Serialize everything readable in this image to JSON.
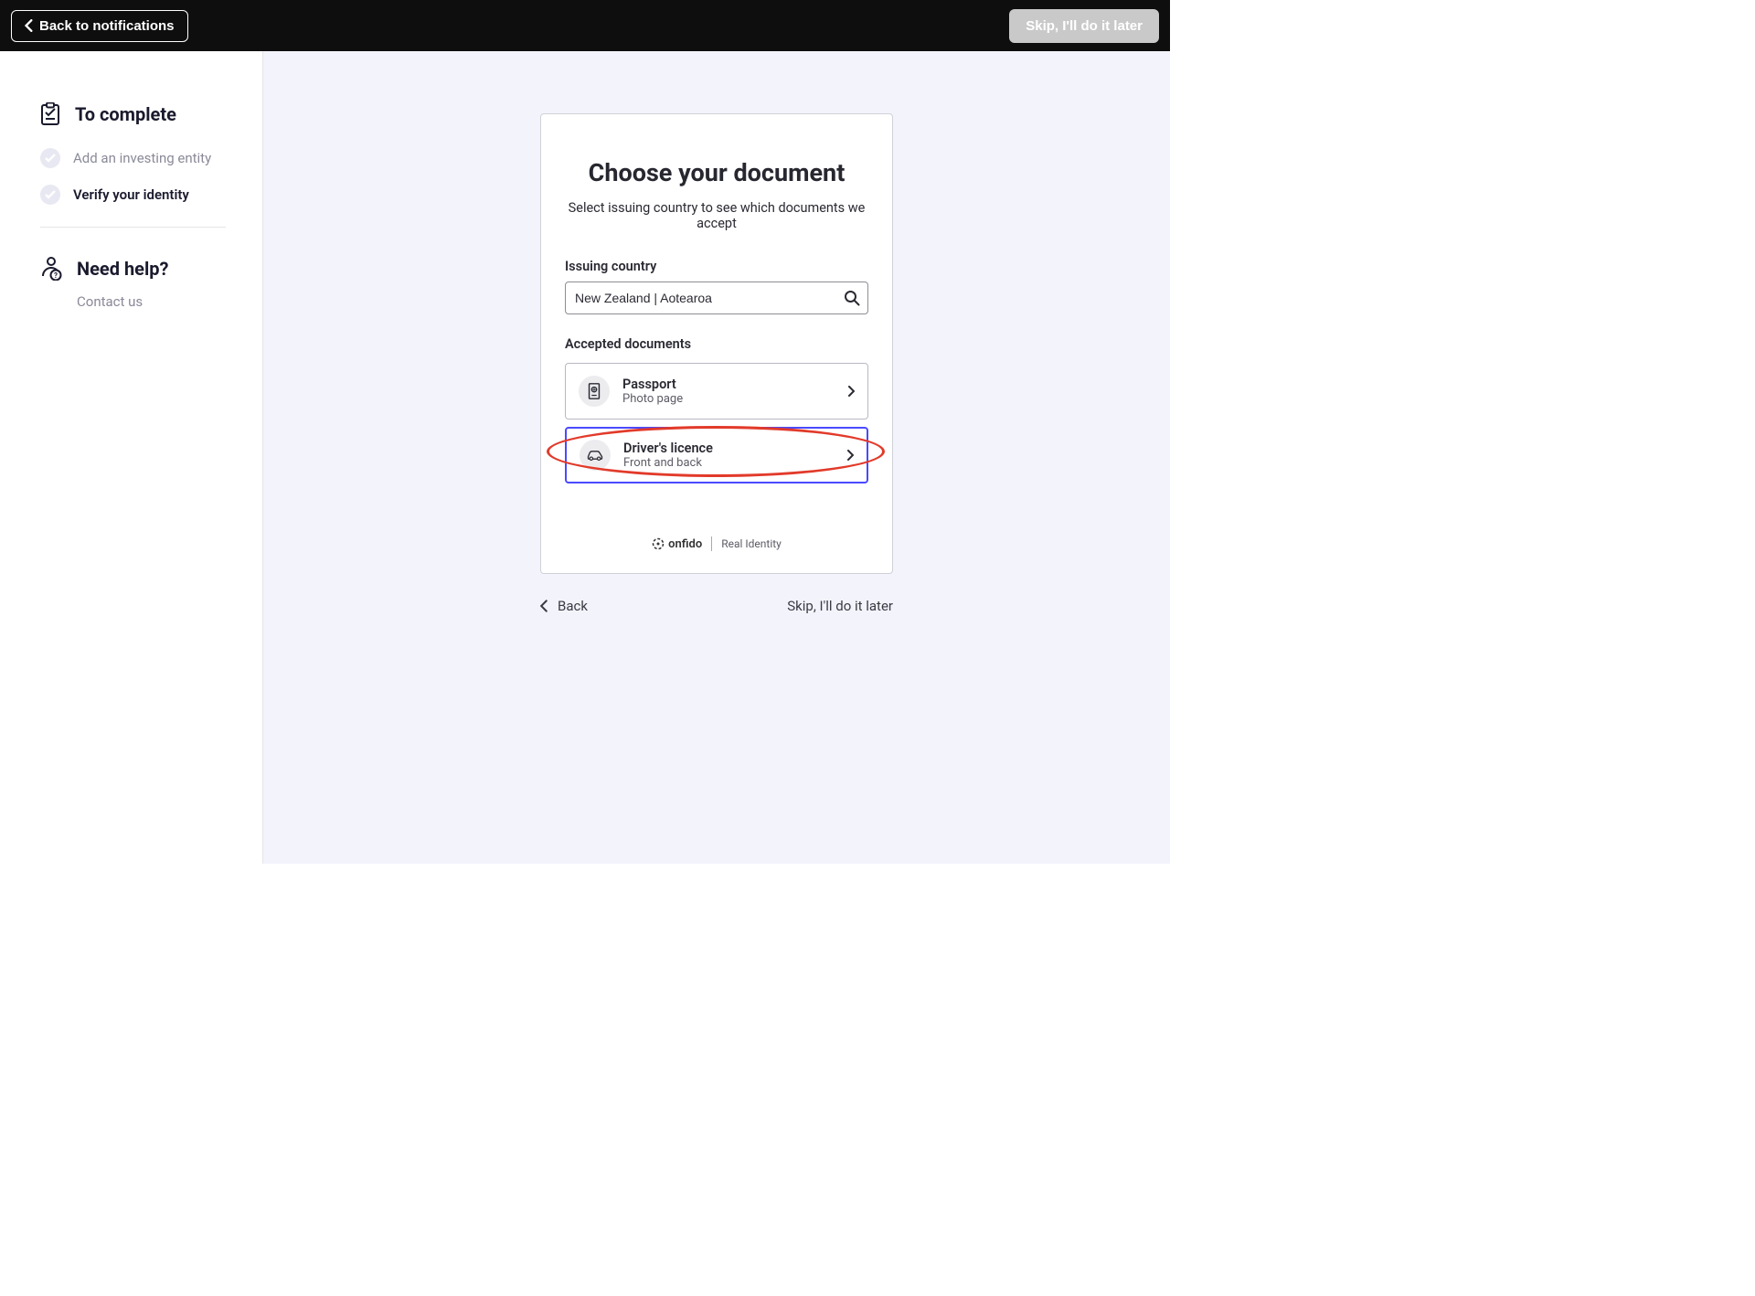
{
  "topbar": {
    "back_label": "Back to notifications",
    "skip_label": "Skip, I'll do it later"
  },
  "sidebar": {
    "to_complete_heading": "To complete",
    "steps": {
      "investing_entity": "Add an investing entity",
      "verify_identity": "Verify your identity"
    },
    "help_heading": "Need help?",
    "contact_us": "Contact us"
  },
  "card": {
    "title": "Choose your document",
    "subtitle": "Select issuing country to see which documents we accept",
    "country_label": "Issuing country",
    "country_value": "New Zealand | Aotearoa",
    "accepted_label": "Accepted documents",
    "docs": {
      "passport": {
        "title": "Passport",
        "desc": "Photo page"
      },
      "licence": {
        "title": "Driver's licence",
        "desc": "Front and back"
      }
    },
    "footer_brand": "onfido",
    "footer_tag": "Real Identity"
  },
  "below": {
    "back_label": "Back",
    "skip_label": "Skip, I'll do it later"
  }
}
